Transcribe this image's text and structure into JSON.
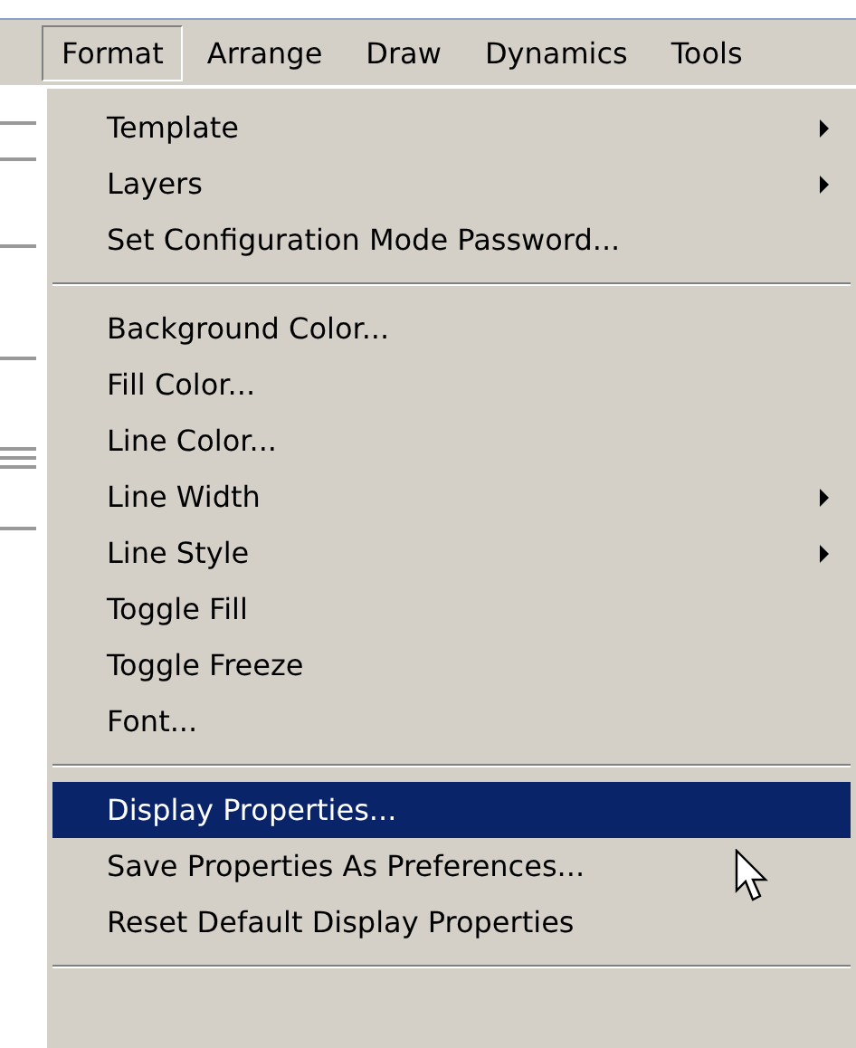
{
  "menu_bar": [
    {
      "label": "Format",
      "selected": true
    },
    {
      "label": "Arrange",
      "selected": false
    },
    {
      "label": "Draw",
      "selected": false
    },
    {
      "label": "Dynamics",
      "selected": false
    },
    {
      "label": "Tools",
      "selected": false
    }
  ],
  "menu": [
    {
      "kind": "submenu",
      "label": "Template",
      "selected": false
    },
    {
      "kind": "submenu",
      "label": "Layers",
      "selected": false
    },
    {
      "kind": "item",
      "label": "Set Configuration Mode Password...",
      "selected": false
    },
    {
      "kind": "separator"
    },
    {
      "kind": "item",
      "label": "Background Color...",
      "selected": false
    },
    {
      "kind": "item",
      "label": "Fill Color...",
      "selected": false
    },
    {
      "kind": "item",
      "label": "Line Color...",
      "selected": false
    },
    {
      "kind": "submenu",
      "label": "Line Width",
      "selected": false
    },
    {
      "kind": "submenu",
      "label": "Line Style",
      "selected": false
    },
    {
      "kind": "item",
      "label": "Toggle Fill",
      "selected": false
    },
    {
      "kind": "item",
      "label": "Toggle Freeze",
      "selected": false
    },
    {
      "kind": "item",
      "label": "Font...",
      "selected": false
    },
    {
      "kind": "separator"
    },
    {
      "kind": "item",
      "label": "Display Properties...",
      "selected": true
    },
    {
      "kind": "item",
      "label": "Save Properties As Preferences...",
      "selected": false
    },
    {
      "kind": "item",
      "label": "Reset Default Display Properties",
      "selected": false
    },
    {
      "kind": "separator"
    }
  ]
}
